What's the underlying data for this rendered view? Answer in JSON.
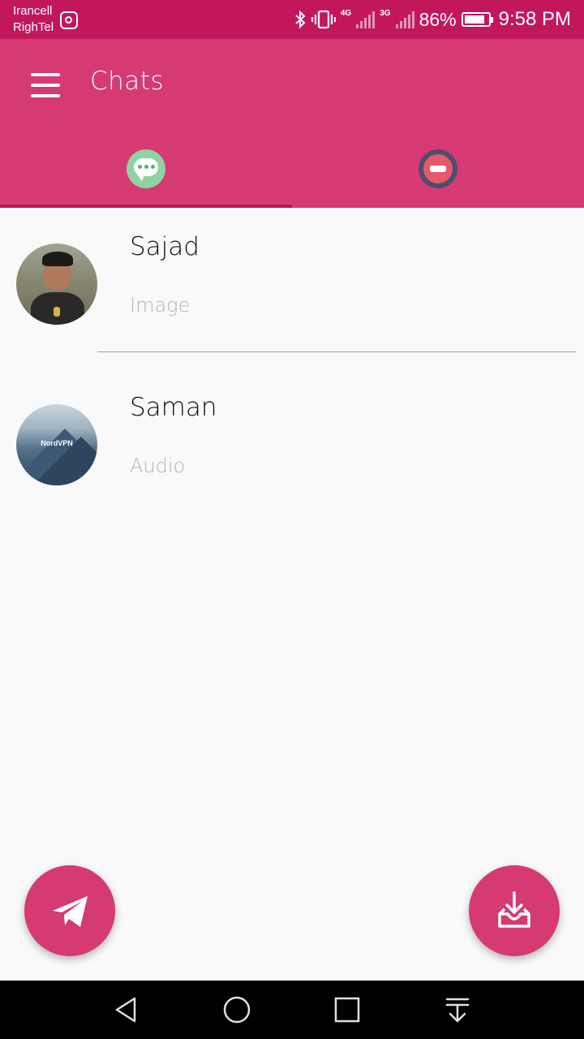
{
  "status_bar": {
    "carrier_1": "Irancell",
    "carrier_2": "RighTel",
    "network_1": "4G",
    "network_2": "3G",
    "battery": "86%",
    "battery_level": 0.86,
    "time": "9:58 PM",
    "icons": [
      "instagram-icon",
      "bluetooth-icon",
      "vibrate-icon",
      "signal-icon",
      "battery-icon"
    ]
  },
  "app_bar": {
    "title": "Chats",
    "menu_icon": "hamburger-menu-icon"
  },
  "tabs": [
    {
      "icon": "chat-bubble-icon",
      "selected": true
    },
    {
      "icon": "blocked-icon",
      "selected": false
    }
  ],
  "chats": [
    {
      "name": "Sajad",
      "preview": "Image"
    },
    {
      "name": "Saman",
      "preview": "Audio",
      "avatar_text": "NordVPN"
    }
  ],
  "fabs": {
    "left_icon": "send-icon",
    "right_icon": "inbox-download-icon"
  },
  "nav_bar": [
    "back-icon",
    "home-icon",
    "recents-icon",
    "notifications-icon"
  ],
  "colors": {
    "status_bar": "#c2185b",
    "primary": "#d63a72",
    "tab_indicator": "#b5174f",
    "background": "#f9f9f9"
  }
}
